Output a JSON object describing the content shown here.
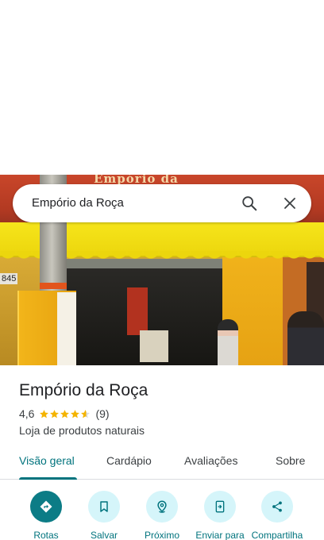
{
  "search": {
    "query": "Empório da Roça",
    "search_icon": "search-icon",
    "close_icon": "close-icon"
  },
  "photo": {
    "sign_text": "Empório da",
    "house_number": "845"
  },
  "place": {
    "name": "Empório da Roça",
    "rating": "4,6",
    "stars": 4.6,
    "review_count": "(9)",
    "category": "Loja de produtos naturais"
  },
  "tabs": [
    {
      "label": "Visão geral",
      "active": true
    },
    {
      "label": "Cardápio",
      "active": false
    },
    {
      "label": "Avaliações",
      "active": false
    },
    {
      "label": "Sobre",
      "active": false
    }
  ],
  "actions": [
    {
      "label": "Rotas",
      "icon": "directions-icon"
    },
    {
      "label": "Salvar",
      "icon": "bookmark-icon"
    },
    {
      "label": "Próximo",
      "icon": "nearby-icon"
    },
    {
      "label": "Enviar para",
      "icon": "send-to-phone-icon"
    },
    {
      "label": "Compartilha",
      "icon": "share-icon"
    }
  ],
  "colors": {
    "accent": "#00737d",
    "primary_button": "#0c7c86",
    "secondary_button": "#d5f5fa",
    "star": "#f4b400"
  }
}
